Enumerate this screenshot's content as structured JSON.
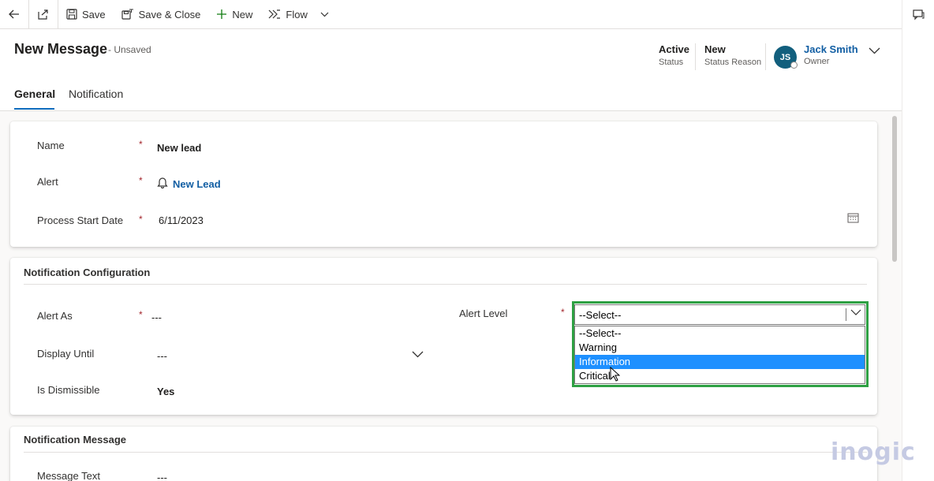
{
  "commandbar": {
    "save": "Save",
    "save_close": "Save & Close",
    "new": "New",
    "flow": "Flow"
  },
  "header": {
    "title": "New Message",
    "subtitle": "- Unsaved",
    "status": {
      "value": "Active",
      "label": "Status"
    },
    "status_reason": {
      "value": "New",
      "label": "Status Reason"
    },
    "owner": {
      "initials": "JS",
      "name": "Jack Smith",
      "label": "Owner"
    }
  },
  "tabs": [
    "General",
    "Notification"
  ],
  "general": {
    "name": {
      "label": "Name",
      "value": "New lead"
    },
    "alert": {
      "label": "Alert",
      "value": "New Lead"
    },
    "process_start_date": {
      "label": "Process Start Date",
      "value": "6/11/2023"
    }
  },
  "notification_config": {
    "title": "Notification Configuration",
    "alert_as": {
      "label": "Alert As",
      "value": "---"
    },
    "display_until": {
      "label": "Display Until",
      "value": "---"
    },
    "is_dismissible": {
      "label": "Is Dismissible",
      "value": "Yes"
    },
    "alert_level": {
      "label": "Alert Level",
      "selected": "--Select--",
      "options": [
        "--Select--",
        "Warning",
        "Information",
        "Critical"
      ],
      "highlighted": "Information"
    }
  },
  "notification_message": {
    "title": "Notification Message",
    "message_text": {
      "label": "Message Text",
      "value": "---"
    }
  },
  "required_marker": "*",
  "watermark": "inogic",
  "colors": {
    "accent": "#0f6cbd",
    "avatar": "#125f7d",
    "highlight_frame": "#2ea043",
    "option_highlight": "#1e90ff",
    "required": "#a4262c"
  }
}
